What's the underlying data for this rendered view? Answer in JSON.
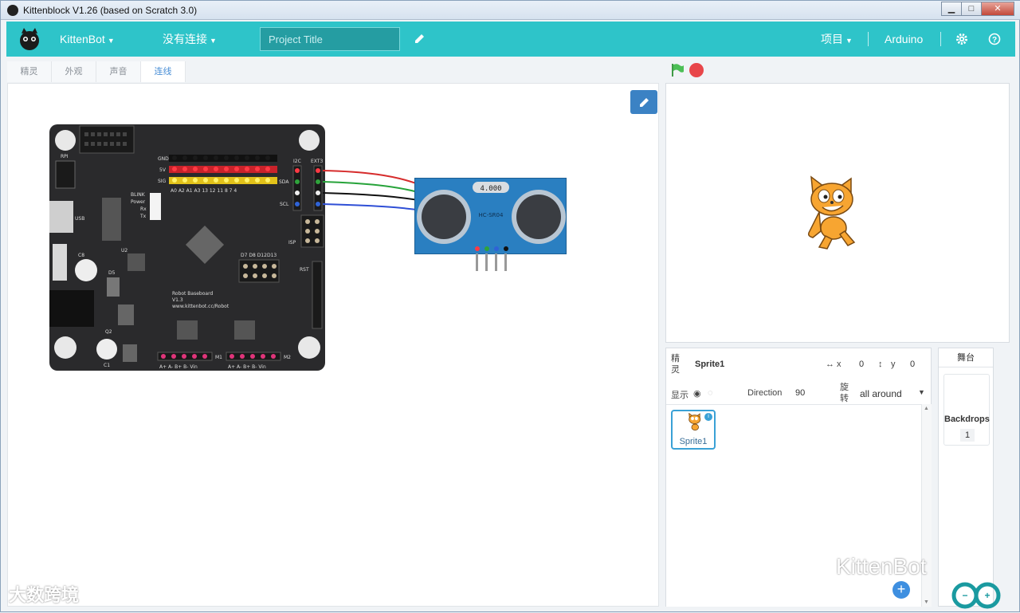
{
  "window": {
    "title": "Kittenblock V1.26 (based on Scratch 3.0)",
    "minimize": "▁",
    "maximize": "□",
    "close": "✕"
  },
  "menubar": {
    "brand": "KittenBot",
    "connection": "没有连接",
    "project_title_placeholder": "Project Title",
    "project_menu": "项目",
    "arduino": "Arduino"
  },
  "tabs": [
    {
      "label": "精灵",
      "active": false
    },
    {
      "label": "外观",
      "active": false
    },
    {
      "label": "声音",
      "active": false
    },
    {
      "label": "连线",
      "active": true
    }
  ],
  "board": {
    "labels": {
      "gnd": "GND",
      "sv": "5V",
      "sig": "SIG",
      "rpi": "RPI",
      "usb": "USB",
      "blink": "BLINK",
      "power": "Power",
      "rx": "Rx",
      "tx": "Tx",
      "c8": "C8",
      "d5": "D5",
      "u2": "U2",
      "q2": "Q2",
      "c1": "C1",
      "i2c": "I2C",
      "sda": "SDA",
      "scl": "SCL",
      "ext3": "EXT3",
      "isp": "ISP",
      "rst": "RST",
      "d7": "D7 D8 D12D13",
      "name": "Robot Baseboard",
      "version": "V1.3",
      "url": "www.kittenbot.cc/Robot",
      "m1": "M1",
      "m2": "M2",
      "motor_pins": "A+  A-  B+  B-  Vin"
    },
    "pins_bottom": "A0  A2  A1  A3  13  12  11  8  7  4"
  },
  "sensor": {
    "crystal": "4.000",
    "model": "HC-SR04"
  },
  "sprite_info": {
    "sprite_label": "精灵",
    "name": "Sprite1",
    "x_label": "x",
    "x": "0",
    "y_label": "y",
    "y": "0",
    "show_label": "显示",
    "direction_label": "Direction",
    "direction": "90",
    "rotation_label": "旋转",
    "rotation_style": "all around"
  },
  "sprites": [
    {
      "name": "Sprite1"
    }
  ],
  "stage_panel": {
    "title": "舞台",
    "backdrops_label": "Backdrops",
    "backdrops_count": "1"
  },
  "watermarks": {
    "bottom_left": "大数跨境",
    "bottom_right": "KittenBot"
  },
  "colors": {
    "accent": "#2ec4c9",
    "flag": "#4cbf56",
    "stop": "#e8464a"
  }
}
